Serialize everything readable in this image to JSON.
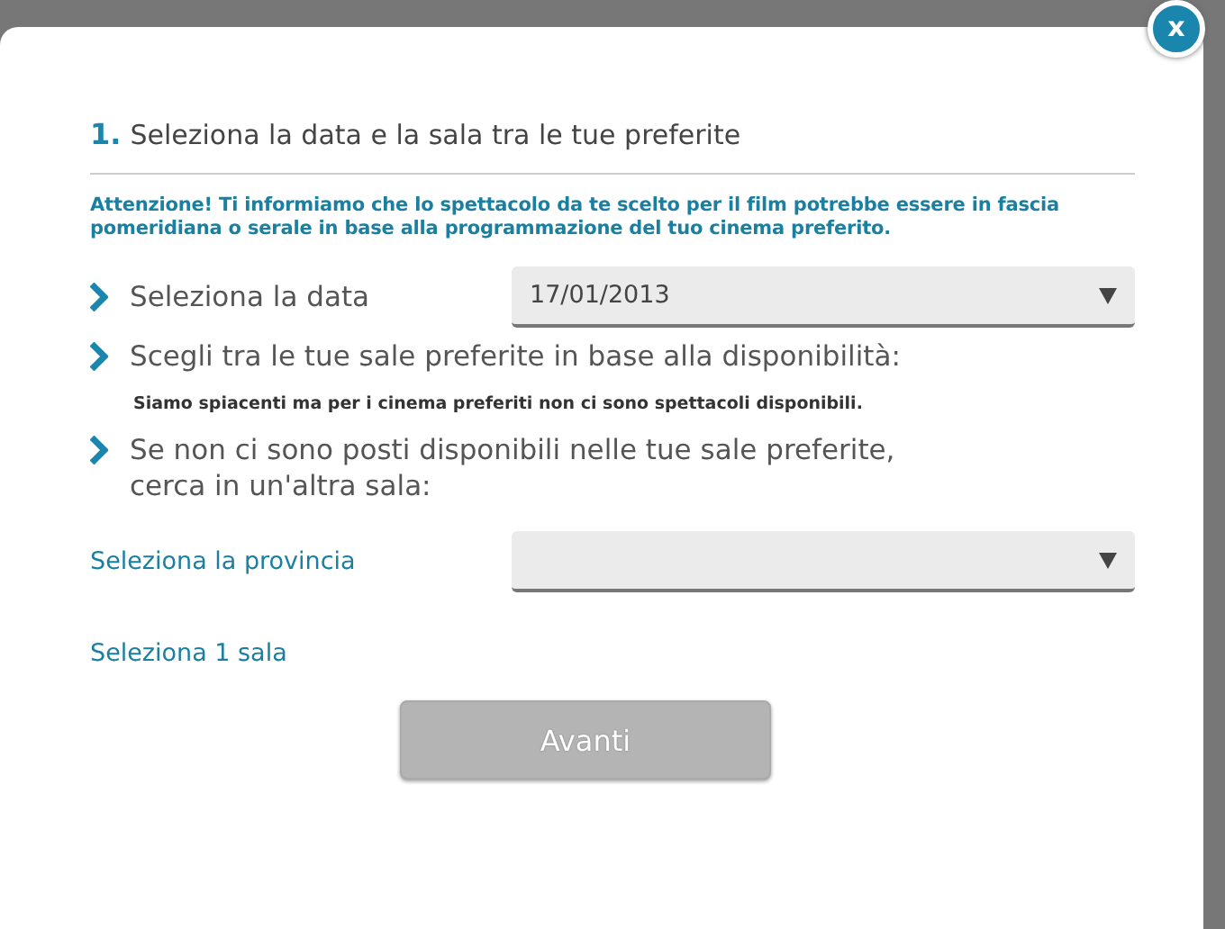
{
  "dialog": {
    "close_label": "x",
    "heading": {
      "number": "1.",
      "text": "Seleziona la data e la sala tra le tue preferite"
    },
    "notice": "Attenzione! Ti informiamo che lo spettacolo da te scelto per il film potrebbe essere in fascia pomeridiana o serale in base alla programmazione del tuo cinema preferito.",
    "steps": [
      {
        "kind": "select",
        "text": "Seleziona la data",
        "value": "17/01/2013"
      },
      {
        "kind": "message",
        "text": "Scegli tra le tue sale preferite in base alla disponibilità:",
        "message": "Siamo spiacenti ma per i cinema preferiti non ci sono spettacoli disponibili."
      },
      {
        "kind": "plain",
        "text": "Se non ci sono posti disponibili nelle tue sale preferite,\ncerca in un'altra sala:"
      }
    ],
    "province": {
      "label": "Seleziona la provincia"
    },
    "hall_label": "Seleziona 1 sala",
    "next_button": {
      "label": "Avanti",
      "disabled": true
    }
  }
}
